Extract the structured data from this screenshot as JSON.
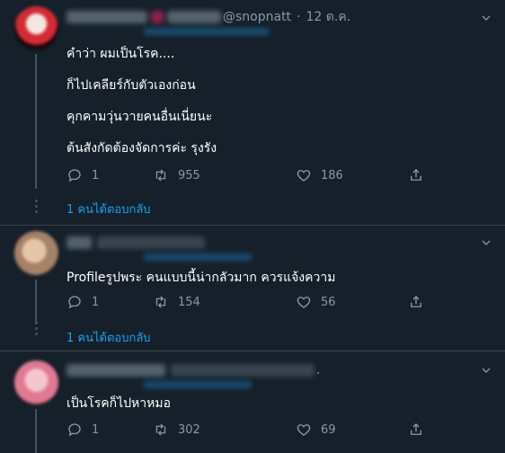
{
  "tweets": [
    {
      "handle": "@snopnatt",
      "separator": "·",
      "date": "12 ต.ค.",
      "lines": [
        "คำว่า ผมเป็นโรค....",
        "ก็ไปเคลียร์กับตัวเองก่อน",
        "คุกคามวุ่นวายคนอื่นเนี่ยนะ",
        "ต้นสังกัดต้องจัดการค่ะ รุงรัง"
      ],
      "replies": "1",
      "retweets": "955",
      "likes": "186",
      "show_replies": "1 คนได้ตอบกลับ"
    },
    {
      "lines": [
        "Profileรูปพระ คนแบบนี้น่ากลัวมาก ควรแจ้งความ"
      ],
      "replies": "1",
      "retweets": "154",
      "likes": "56",
      "show_replies": "1 คนได้ตอบกลับ"
    },
    {
      "trailing_dot": ".",
      "lines": [
        "เป็นโรคก็ไปหาหมอ"
      ],
      "replies": "1",
      "retweets": "302",
      "likes": "69"
    }
  ],
  "colors": {
    "background": "#15202b",
    "border": "#38444d",
    "muted": "#8899a6",
    "accent": "#1da1f2"
  }
}
